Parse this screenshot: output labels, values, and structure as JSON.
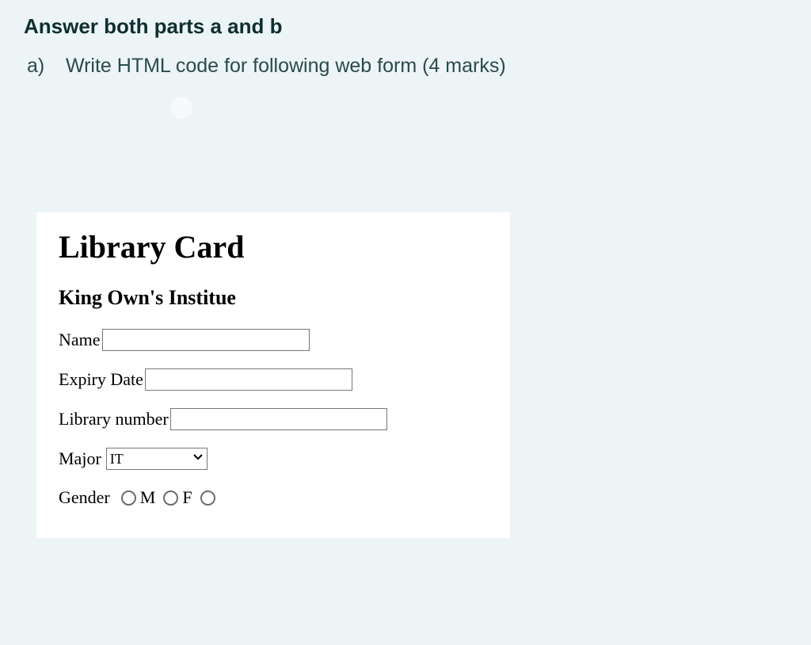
{
  "instruction": "Answer both parts a and b",
  "partA": {
    "label": "a)",
    "text": "Write HTML code for following web form (4 marks)"
  },
  "form": {
    "title": "Library Card",
    "subtitle": "King Own's Institue",
    "fields": {
      "name": {
        "label": "Name",
        "value": ""
      },
      "expiry": {
        "label": "Expiry Date",
        "value": ""
      },
      "libnum": {
        "label": "Library number",
        "value": ""
      },
      "major": {
        "label": "Major",
        "selected": "IT"
      },
      "gender": {
        "label": "Gender",
        "options": {
          "m": "M",
          "f": "F",
          "blank": ""
        }
      }
    }
  }
}
